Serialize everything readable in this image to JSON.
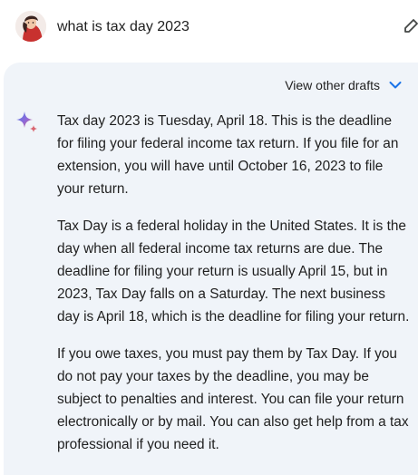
{
  "prompt": {
    "text": "what is tax day 2023"
  },
  "response": {
    "drafts_label": "View other drafts",
    "paragraphs": [
      "Tax day 2023 is Tuesday, April 18. This is the deadline for filing your federal income tax return. If you file for an extension, you will have until October 16, 2023 to file your return.",
      "Tax Day is a federal holiday in the United States. It is the day when all federal income tax returns are due. The deadline for filing your return is usually April 15, but in 2023, Tax Day falls on a Saturday. The next business day is April 18, which is the deadline for filing your return.",
      "If you owe taxes, you must pay them by Tax Day. If you do not pay your taxes by the deadline, you may be subject to penalties and interest. You can file your return electronically or by mail. You can also get help from a tax professional if you need it."
    ]
  },
  "icons": {
    "avatar": "user-avatar",
    "edit": "pencil-icon",
    "drafts_chevron": "chevron-down-icon",
    "assistant": "sparkle-icon"
  },
  "colors": {
    "response_background": "#f0f4f9",
    "accent": "#1a73e8",
    "text": "#1f1f1f"
  }
}
